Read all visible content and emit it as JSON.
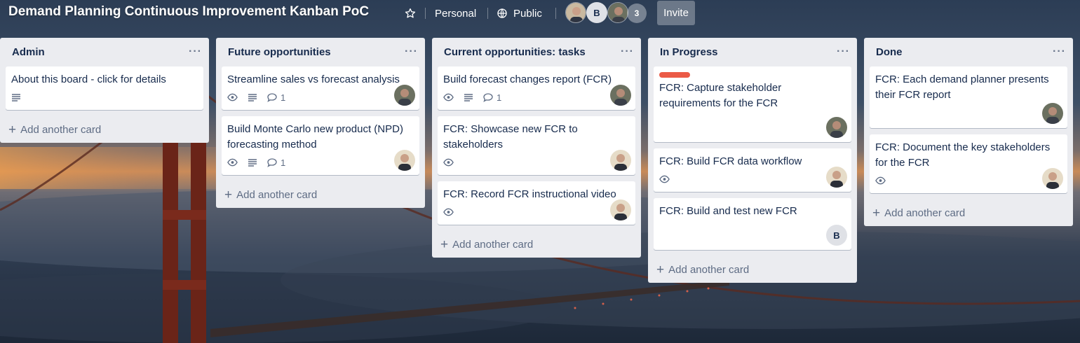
{
  "board": {
    "title": "Demand Planning Continuous Improvement Kanban PoC",
    "visibility_team": "Personal",
    "visibility_access": "Public",
    "member_initial": "B",
    "member_count": "3",
    "invite_label": "Invite"
  },
  "icons": {
    "star": "star-icon",
    "globe": "globe-icon",
    "eye": "eye-icon",
    "description": "description-icon",
    "comment": "comment-icon"
  },
  "colors": {
    "list_bg": "#ebecf0",
    "card_bg": "#ffffff",
    "text": "#172b4d",
    "label_red": "#eb5a46"
  },
  "lists": [
    {
      "title": "Admin",
      "add_label": "Add another card",
      "cards": [
        {
          "title": "About this board - click for details",
          "badges": [
            "description"
          ]
        }
      ]
    },
    {
      "title": "Future opportunities",
      "add_label": "Add another card",
      "cards": [
        {
          "title": "Streamline sales vs forecast analysis",
          "badges": [
            "eye",
            "description",
            "comment"
          ],
          "comments": "1",
          "member": "avatar"
        },
        {
          "title": "Build Monte Carlo new product (NPD) forecasting method",
          "badges": [
            "eye",
            "description",
            "comment"
          ],
          "comments": "1",
          "member": "avatar"
        }
      ]
    },
    {
      "title": "Current opportunities: tasks",
      "add_label": "Add another card",
      "cards": [
        {
          "title": "Build forecast changes report (FCR)",
          "badges": [
            "eye",
            "description",
            "comment"
          ],
          "comments": "1",
          "member": "avatar"
        },
        {
          "title": "FCR: Showcase new FCR to stakeholders",
          "badges": [
            "eye"
          ],
          "member": "avatar"
        },
        {
          "title": "FCR: Record FCR instructional video",
          "badges": [
            "eye"
          ],
          "member": "avatar"
        }
      ]
    },
    {
      "title": "In Progress",
      "add_label": "Add another card",
      "cards": [
        {
          "title": "FCR: Capture stakeholder requirements for the FCR",
          "label": "red",
          "member": "avatar"
        },
        {
          "title": "FCR: Build FCR data workflow",
          "badges": [
            "eye"
          ],
          "member": "avatar"
        },
        {
          "title": "FCR: Build and test new FCR",
          "member_initial": "B"
        }
      ]
    },
    {
      "title": "Done",
      "add_label": "Add another card",
      "cards": [
        {
          "title": "FCR: Each demand planner presents their FCR report",
          "member": "avatar"
        },
        {
          "title": "FCR: Document the key stakeholders for the FCR",
          "badges": [
            "eye"
          ],
          "member": "avatar"
        }
      ]
    }
  ]
}
